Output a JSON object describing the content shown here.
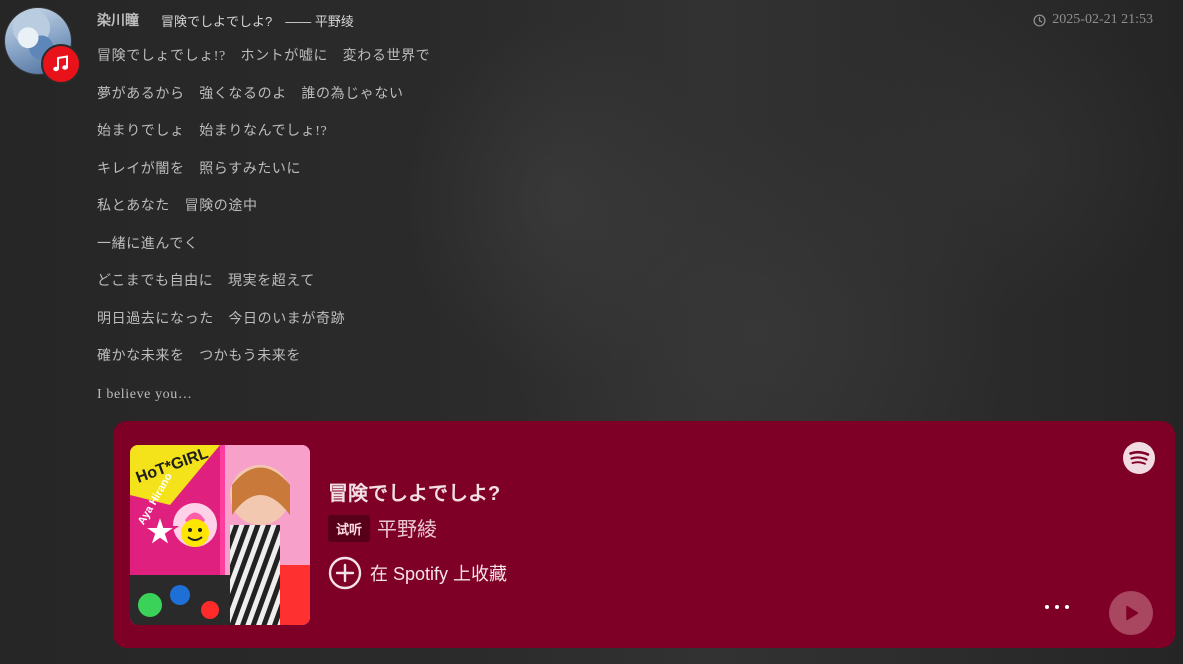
{
  "post": {
    "username": "染川瞳",
    "song_ref": "冒険でしよでしよ?　—— 平野绫",
    "timestamp": "2025-02-21 21:53",
    "lyrics": [
      "冒険でしょでしょ!?　ホントが嘘に　変わる世界で",
      "夢があるから　強くなるのよ　誰の為じゃない",
      "始まりでしょ　始まりなんでしょ!?",
      "キレイが闇を　照らすみたいに",
      "私とあなた　冒険の途中",
      "一緒に進んでく",
      "どこまでも自由に　現実を超えて",
      "明日過去になった　今日のいまが奇跡",
      "確かな未来を　つかもう未来を",
      "I believe you…"
    ]
  },
  "card": {
    "title": "冒険でしよでしよ?",
    "preview_tag": "试听",
    "artist": "平野綾",
    "save_label": "在 Spotify 上收藏",
    "background_color": "#7f0026",
    "cover_text": "HoT*GIRL",
    "cover_artist": "Aya Hirano",
    "icons": {
      "brand": "spotify-icon",
      "save": "plus-circle-icon",
      "more": "more-dots-icon",
      "play": "play-icon"
    }
  },
  "icons": {
    "badge": "music-note-icon",
    "time": "clock-icon"
  }
}
